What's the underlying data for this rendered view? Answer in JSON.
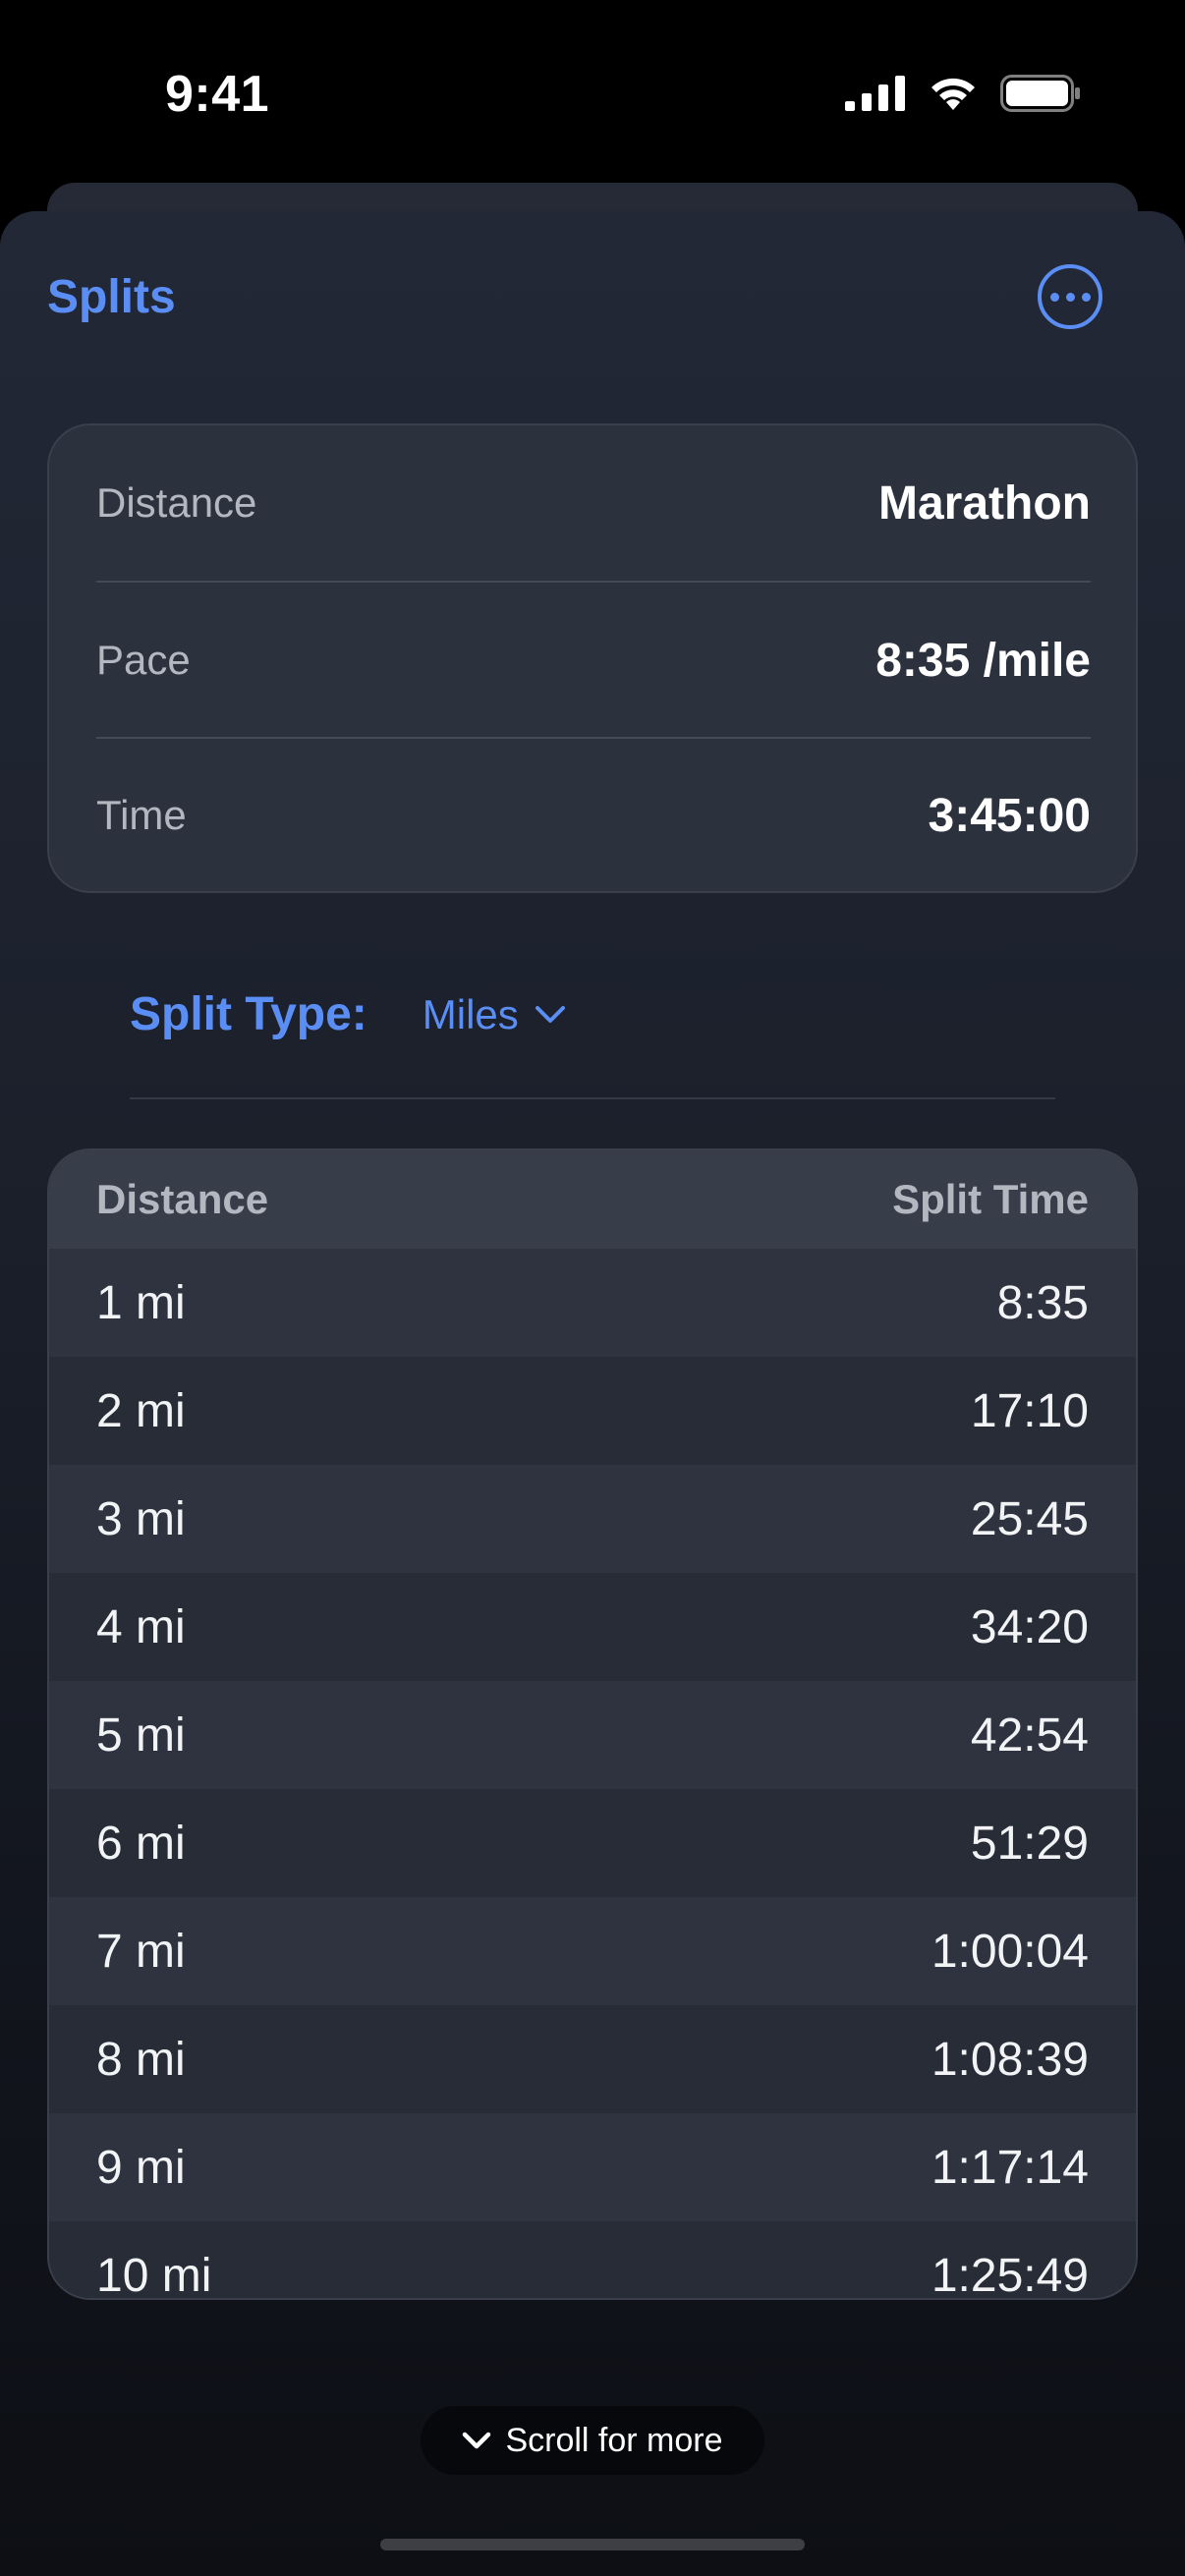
{
  "status_bar": {
    "time": "9:41",
    "icons": [
      "cellular-signal-icon",
      "wifi-icon",
      "battery-icon"
    ]
  },
  "header": {
    "title": "Splits",
    "more_icon": "ellipsis-circle-icon"
  },
  "summary": {
    "rows": [
      {
        "label": "Distance",
        "value": "Marathon"
      },
      {
        "label": "Pace",
        "value": "8:35 /mile"
      },
      {
        "label": "Time",
        "value": "3:45:00"
      }
    ]
  },
  "split_type": {
    "label": "Split Type:",
    "selected": "Miles",
    "icon": "chevron-down-icon"
  },
  "table": {
    "headers": [
      "Distance",
      "Split Time"
    ],
    "rows": [
      {
        "distance": "1 mi",
        "time": "8:35"
      },
      {
        "distance": "2 mi",
        "time": "17:10"
      },
      {
        "distance": "3 mi",
        "time": "25:45"
      },
      {
        "distance": "4 mi",
        "time": "34:20"
      },
      {
        "distance": "5 mi",
        "time": "42:54"
      },
      {
        "distance": "6 mi",
        "time": "51:29"
      },
      {
        "distance": "7 mi",
        "time": "1:00:04"
      },
      {
        "distance": "8 mi",
        "time": "1:08:39"
      },
      {
        "distance": "9 mi",
        "time": "1:17:14"
      },
      {
        "distance": "10 mi",
        "time": "1:25:49"
      }
    ]
  },
  "scroll_hint": {
    "label": "Scroll for more",
    "icon": "chevron-down-icon"
  },
  "colors": {
    "accent": "#5b8ef4",
    "background": "#000000",
    "card": "#2c313e"
  }
}
